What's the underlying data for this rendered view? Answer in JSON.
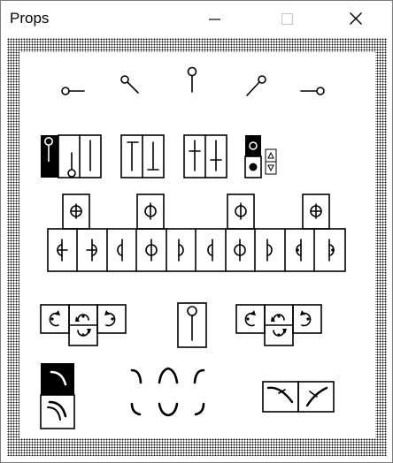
{
  "window": {
    "title": "Props",
    "controls": [
      "minimize-icon",
      "maximize-icon",
      "close-icon"
    ]
  },
  "colors": {
    "title_text": "#000000",
    "frame_dots": "#111111",
    "selected_fill": "#000000",
    "control_disabled": "#c8c8c8"
  },
  "toolbox": {
    "selected_stand_item": "stand-top-left",
    "selected_color_item": "black-circle",
    "selected_curve_item": "curve-top-left"
  }
}
